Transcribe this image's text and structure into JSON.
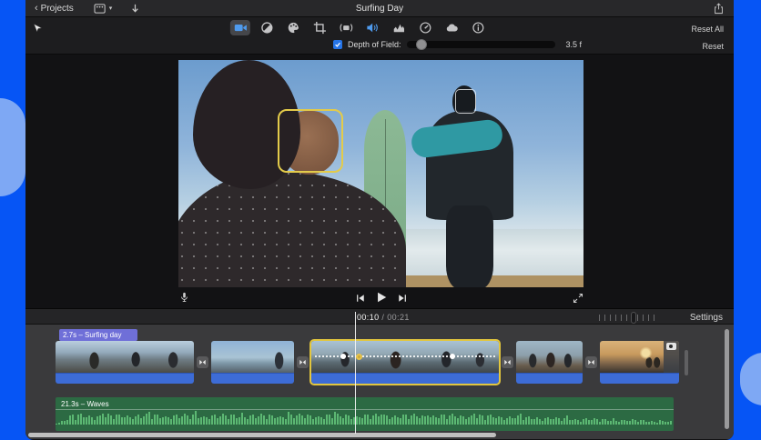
{
  "colors": {
    "desktop_blue": "#0655f5",
    "desktop_light_blue": "#7ea8f4",
    "accent_blue": "#4f9bee",
    "selection_yellow": "#e2c63e",
    "clip_audio_blue": "#3d6cd6",
    "audio_clip_green": "#2c6a43",
    "waveform_green": "#5cb873",
    "badge_purple": "#6f6fd8"
  },
  "titlebar": {
    "back_label": "Projects",
    "title": "Surfing Day",
    "icons": [
      "media-browser-icon",
      "import-arrow-icon",
      "share-icon"
    ]
  },
  "inspector": {
    "reset_all_label": "Reset All",
    "tools": [
      {
        "id": "video-adjust",
        "icon": "camera-icon",
        "selected": true
      },
      {
        "id": "color-correction",
        "icon": "contrast-icon"
      },
      {
        "id": "color-board",
        "icon": "palette-icon"
      },
      {
        "id": "crop",
        "icon": "crop-icon"
      },
      {
        "id": "stabilization",
        "icon": "stabilize-icon"
      },
      {
        "id": "volume",
        "icon": "speaker-icon",
        "accent": true
      },
      {
        "id": "audio-eq",
        "icon": "eq-bars-icon"
      },
      {
        "id": "speed",
        "icon": "speedometer-icon"
      },
      {
        "id": "noise-reduction",
        "icon": "cloud-icon"
      },
      {
        "id": "info",
        "icon": "info-icon"
      }
    ],
    "depth_of_field": {
      "label": "Depth of Field:",
      "checked": true,
      "slider_percent": 10,
      "value": "3.5 f",
      "reset_label": "Reset"
    }
  },
  "viewer": {
    "face_overlays": [
      {
        "id": "primary-face",
        "style": "focused-yellow"
      },
      {
        "id": "secondary-face",
        "style": "unfocused-white"
      }
    ],
    "controls": [
      "microphone-icon",
      "skip-back-icon",
      "play-icon",
      "skip-forward-icon",
      "fullscreen-icon"
    ]
  },
  "timeline": {
    "timecode": {
      "current": "00:10",
      "separator": " / ",
      "total": "00:21"
    },
    "zoom_slider_percent": 62,
    "settings_label": "Settings",
    "video_clip_badge": "2.7s – Surfing day",
    "audio_clip_label": "21.3s – Waves",
    "clips": [
      {
        "type": "video",
        "id": "c1",
        "name": "clip-1"
      },
      {
        "type": "transition"
      },
      {
        "type": "video",
        "id": "c2",
        "name": "clip-2"
      },
      {
        "type": "transition"
      },
      {
        "type": "video",
        "id": "c3",
        "name": "clip-3",
        "selected": true,
        "speed_dots": [
          35,
          52,
          155
        ]
      },
      {
        "type": "transition"
      },
      {
        "type": "video",
        "id": "c4",
        "name": "clip-4"
      },
      {
        "type": "transition"
      },
      {
        "type": "video",
        "id": "c5",
        "name": "clip-5",
        "camera_badge": true
      }
    ]
  }
}
